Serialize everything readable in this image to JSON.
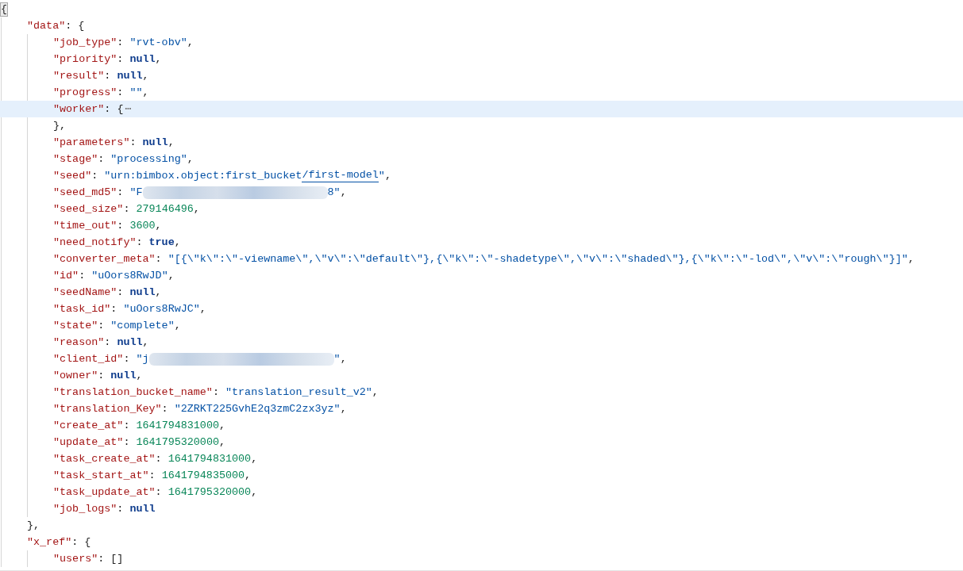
{
  "editor": {
    "lines": [
      {
        "current": false,
        "tokens": [
          {
            "kind": "matched_bracket",
            "text": "{"
          }
        ],
        "children": [
          {
            "current": false,
            "tokens": [
              {
                "kind": "key",
                "text": "\"data\""
              },
              {
                "kind": "colon",
                "text": ":"
              },
              {
                "kind": "punct",
                "text": "{"
              }
            ],
            "end": [
              {
                "kind": "punct",
                "text": "},"
              }
            ],
            "children": [
              {
                "current": false,
                "tokens": [
                  {
                    "kind": "key",
                    "text": "\"job_type\""
                  },
                  {
                    "kind": "colon",
                    "text": ":"
                  },
                  {
                    "kind": "string",
                    "text": "\"rvt-obv\""
                  },
                  {
                    "kind": "punct",
                    "text": ","
                  }
                ]
              },
              {
                "current": false,
                "tokens": [
                  {
                    "kind": "key",
                    "text": "\"priority\""
                  },
                  {
                    "kind": "colon",
                    "text": ":"
                  },
                  {
                    "kind": "keyword",
                    "text": "null"
                  },
                  {
                    "kind": "punct",
                    "text": ","
                  }
                ]
              },
              {
                "current": false,
                "tokens": [
                  {
                    "kind": "key",
                    "text": "\"result\""
                  },
                  {
                    "kind": "colon",
                    "text": ":"
                  },
                  {
                    "kind": "keyword",
                    "text": "null"
                  },
                  {
                    "kind": "punct",
                    "text": ","
                  }
                ]
              },
              {
                "current": false,
                "tokens": [
                  {
                    "kind": "key",
                    "text": "\"progress\""
                  },
                  {
                    "kind": "colon",
                    "text": ":"
                  },
                  {
                    "kind": "string",
                    "text": "\"\""
                  },
                  {
                    "kind": "punct",
                    "text": ","
                  }
                ]
              },
              {
                "current": true,
                "tokens": [
                  {
                    "kind": "key",
                    "text": "\"worker\""
                  },
                  {
                    "kind": "colon",
                    "text": ":"
                  },
                  {
                    "kind": "punct",
                    "text": "{"
                  },
                  {
                    "kind": "fold",
                    "text": "⋯"
                  }
                ],
                "end": [
                  {
                    "kind": "punct",
                    "text": "},"
                  }
                ]
              },
              {
                "current": false,
                "tokens": [
                  {
                    "kind": "key",
                    "text": "\"parameters\""
                  },
                  {
                    "kind": "colon",
                    "text": ":"
                  },
                  {
                    "kind": "keyword",
                    "text": "null"
                  },
                  {
                    "kind": "punct",
                    "text": ","
                  }
                ]
              },
              {
                "current": false,
                "tokens": [
                  {
                    "kind": "key",
                    "text": "\"stage\""
                  },
                  {
                    "kind": "colon",
                    "text": ":"
                  },
                  {
                    "kind": "string",
                    "text": "\"processing\""
                  },
                  {
                    "kind": "punct",
                    "text": ","
                  }
                ]
              },
              {
                "current": false,
                "tokens": [
                  {
                    "kind": "key",
                    "text": "\"seed\""
                  },
                  {
                    "kind": "colon",
                    "text": ":"
                  },
                  {
                    "kind": "string",
                    "text": "\"urn:bimbox.object:first_bucket"
                  },
                  {
                    "kind": "link",
                    "text": "/first-model"
                  },
                  {
                    "kind": "string",
                    "text": "\""
                  },
                  {
                    "kind": "punct",
                    "text": ","
                  }
                ]
              },
              {
                "current": false,
                "tokens": [
                  {
                    "kind": "key",
                    "text": "\"seed_md5\""
                  },
                  {
                    "kind": "colon",
                    "text": ":"
                  },
                  {
                    "kind": "string",
                    "text": "\"F"
                  },
                  {
                    "kind": "redacted"
                  },
                  {
                    "kind": "string",
                    "text": "8\""
                  },
                  {
                    "kind": "punct",
                    "text": ","
                  }
                ]
              },
              {
                "current": false,
                "tokens": [
                  {
                    "kind": "key",
                    "text": "\"seed_size\""
                  },
                  {
                    "kind": "colon",
                    "text": ":"
                  },
                  {
                    "kind": "number",
                    "text": "279146496"
                  },
                  {
                    "kind": "punct",
                    "text": ","
                  }
                ]
              },
              {
                "current": false,
                "tokens": [
                  {
                    "kind": "key",
                    "text": "\"time_out\""
                  },
                  {
                    "kind": "colon",
                    "text": ":"
                  },
                  {
                    "kind": "number",
                    "text": "3600"
                  },
                  {
                    "kind": "punct",
                    "text": ","
                  }
                ]
              },
              {
                "current": false,
                "tokens": [
                  {
                    "kind": "key",
                    "text": "\"need_notify\""
                  },
                  {
                    "kind": "colon",
                    "text": ":"
                  },
                  {
                    "kind": "keyword",
                    "text": "true"
                  },
                  {
                    "kind": "punct",
                    "text": ","
                  }
                ]
              },
              {
                "current": false,
                "tokens": [
                  {
                    "kind": "key",
                    "text": "\"converter_meta\""
                  },
                  {
                    "kind": "colon",
                    "text": ":"
                  },
                  {
                    "kind": "string",
                    "text": "\"[{\\\"k\\\":\\\"-viewname\\\",\\\"v\\\":\\\"default\\\"},{\\\"k\\\":\\\"-shadetype\\\",\\\"v\\\":\\\"shaded\\\"},{\\\"k\\\":\\\"-lod\\\",\\\"v\\\":\\\"rough\\\"}]\""
                  },
                  {
                    "kind": "punct",
                    "text": ","
                  }
                ]
              },
              {
                "current": false,
                "tokens": [
                  {
                    "kind": "key",
                    "text": "\"id\""
                  },
                  {
                    "kind": "colon",
                    "text": ":"
                  },
                  {
                    "kind": "string",
                    "text": "\"uOors8RwJD\""
                  },
                  {
                    "kind": "punct",
                    "text": ","
                  }
                ]
              },
              {
                "current": false,
                "tokens": [
                  {
                    "kind": "key",
                    "text": "\"seedName\""
                  },
                  {
                    "kind": "colon",
                    "text": ":"
                  },
                  {
                    "kind": "keyword",
                    "text": "null"
                  },
                  {
                    "kind": "punct",
                    "text": ","
                  }
                ]
              },
              {
                "current": false,
                "tokens": [
                  {
                    "kind": "key",
                    "text": "\"task_id\""
                  },
                  {
                    "kind": "colon",
                    "text": ":"
                  },
                  {
                    "kind": "string",
                    "text": "\"uOors8RwJC\""
                  },
                  {
                    "kind": "punct",
                    "text": ","
                  }
                ]
              },
              {
                "current": false,
                "tokens": [
                  {
                    "kind": "key",
                    "text": "\"state\""
                  },
                  {
                    "kind": "colon",
                    "text": ":"
                  },
                  {
                    "kind": "string",
                    "text": "\"complete\""
                  },
                  {
                    "kind": "punct",
                    "text": ","
                  }
                ]
              },
              {
                "current": false,
                "tokens": [
                  {
                    "kind": "key",
                    "text": "\"reason\""
                  },
                  {
                    "kind": "colon",
                    "text": ":"
                  },
                  {
                    "kind": "keyword",
                    "text": "null"
                  },
                  {
                    "kind": "punct",
                    "text": ","
                  }
                ]
              },
              {
                "current": false,
                "tokens": [
                  {
                    "kind": "key",
                    "text": "\"client_id\""
                  },
                  {
                    "kind": "colon",
                    "text": ":"
                  },
                  {
                    "kind": "string",
                    "text": "\"j"
                  },
                  {
                    "kind": "redacted"
                  },
                  {
                    "kind": "string",
                    "text": "\""
                  },
                  {
                    "kind": "punct",
                    "text": ","
                  }
                ]
              },
              {
                "current": false,
                "tokens": [
                  {
                    "kind": "key",
                    "text": "\"owner\""
                  },
                  {
                    "kind": "colon",
                    "text": ":"
                  },
                  {
                    "kind": "keyword",
                    "text": "null"
                  },
                  {
                    "kind": "punct",
                    "text": ","
                  }
                ]
              },
              {
                "current": false,
                "tokens": [
                  {
                    "kind": "key",
                    "text": "\"translation_bucket_name\""
                  },
                  {
                    "kind": "colon",
                    "text": ":"
                  },
                  {
                    "kind": "string",
                    "text": "\"translation_result_v2\""
                  },
                  {
                    "kind": "punct",
                    "text": ","
                  }
                ]
              },
              {
                "current": false,
                "tokens": [
                  {
                    "kind": "key",
                    "text": "\"translation_Key\""
                  },
                  {
                    "kind": "colon",
                    "text": ":"
                  },
                  {
                    "kind": "string",
                    "text": "\"2ZRKT225GvhE2q3zmC2zx3yz\""
                  },
                  {
                    "kind": "punct",
                    "text": ","
                  }
                ]
              },
              {
                "current": false,
                "tokens": [
                  {
                    "kind": "key",
                    "text": "\"create_at\""
                  },
                  {
                    "kind": "colon",
                    "text": ":"
                  },
                  {
                    "kind": "number",
                    "text": "1641794831000"
                  },
                  {
                    "kind": "punct",
                    "text": ","
                  }
                ]
              },
              {
                "current": false,
                "tokens": [
                  {
                    "kind": "key",
                    "text": "\"update_at\""
                  },
                  {
                    "kind": "colon",
                    "text": ":"
                  },
                  {
                    "kind": "number",
                    "text": "1641795320000"
                  },
                  {
                    "kind": "punct",
                    "text": ","
                  }
                ]
              },
              {
                "current": false,
                "tokens": [
                  {
                    "kind": "key",
                    "text": "\"task_create_at\""
                  },
                  {
                    "kind": "colon",
                    "text": ":"
                  },
                  {
                    "kind": "number",
                    "text": "1641794831000"
                  },
                  {
                    "kind": "punct",
                    "text": ","
                  }
                ]
              },
              {
                "current": false,
                "tokens": [
                  {
                    "kind": "key",
                    "text": "\"task_start_at\""
                  },
                  {
                    "kind": "colon",
                    "text": ":"
                  },
                  {
                    "kind": "number",
                    "text": "1641794835000"
                  },
                  {
                    "kind": "punct",
                    "text": ","
                  }
                ]
              },
              {
                "current": false,
                "tokens": [
                  {
                    "kind": "key",
                    "text": "\"task_update_at\""
                  },
                  {
                    "kind": "colon",
                    "text": ":"
                  },
                  {
                    "kind": "number",
                    "text": "1641795320000"
                  },
                  {
                    "kind": "punct",
                    "text": ","
                  }
                ]
              },
              {
                "current": false,
                "tokens": [
                  {
                    "kind": "key",
                    "text": "\"job_logs\""
                  },
                  {
                    "kind": "colon",
                    "text": ":"
                  },
                  {
                    "kind": "keyword",
                    "text": "null"
                  }
                ]
              }
            ]
          },
          {
            "current": false,
            "tokens": [
              {
                "kind": "key",
                "text": "\"x_ref\""
              },
              {
                "kind": "colon",
                "text": ":"
              },
              {
                "kind": "punct",
                "text": "{"
              }
            ],
            "children": [
              {
                "current": false,
                "tokens": [
                  {
                    "kind": "key",
                    "text": "\"users\""
                  },
                  {
                    "kind": "colon",
                    "text": ":"
                  },
                  {
                    "kind": "punct",
                    "text": "[]"
                  }
                ]
              }
            ]
          }
        ]
      }
    ]
  }
}
